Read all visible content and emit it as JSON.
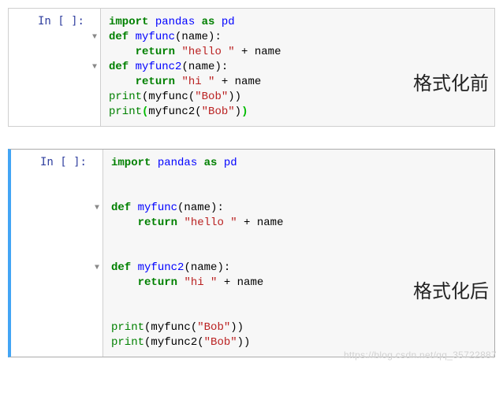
{
  "prompt_label": "In [ ]:",
  "annotation_before": "格式化前",
  "annotation_after": "格式化后",
  "watermark": "https://blog.csdn.net/qq_35722887",
  "cell1": {
    "l1_import": "import",
    "l1_space": " ",
    "l1_pandas": "pandas",
    "l1_as": "as",
    "l1_pd": "pd",
    "l2_def": "def",
    "l2_name": " myfunc",
    "l2_rest": "(name):",
    "l3_ret": "return",
    "l3_str": "\"hello \"",
    "l3_plus": " + name",
    "l4_def": "def",
    "l4_name": " myfunc2",
    "l4_rest": "(name):",
    "l5_ret": "return",
    "l5_str": "\"hi \"",
    "l5_plus": " + name",
    "l6_print": "print",
    "l6_mid": "(myfunc(",
    "l6_str": "\"Bob\"",
    "l6_end": "))",
    "l7_print": "print",
    "l7_open1": "(",
    "l7_mid": "myfunc2(",
    "l7_str": "\"Bob\"",
    "l7_close1": ")",
    "l7_close2": ")"
  },
  "cell2": {
    "l1_import": "import",
    "l1_pandas": " pandas ",
    "l1_as": "as",
    "l1_pd": " pd",
    "l3_def": "def",
    "l3_name": " myfunc",
    "l3_rest": "(name):",
    "l4_ret": "return",
    "l4_str": "\"hello \"",
    "l4_plus": " + name",
    "l6_def": "def",
    "l6_name": " myfunc2",
    "l6_rest": "(name):",
    "l7_ret": "return",
    "l7_str": "\"hi \"",
    "l7_plus": " + name",
    "l9_print": "print",
    "l9_mid": "(myfunc(",
    "l9_str": "\"Bob\"",
    "l9_end": "))",
    "l10_print": "print",
    "l10_mid": "(myfunc2(",
    "l10_str": "\"Bob\"",
    "l10_end": "))"
  }
}
